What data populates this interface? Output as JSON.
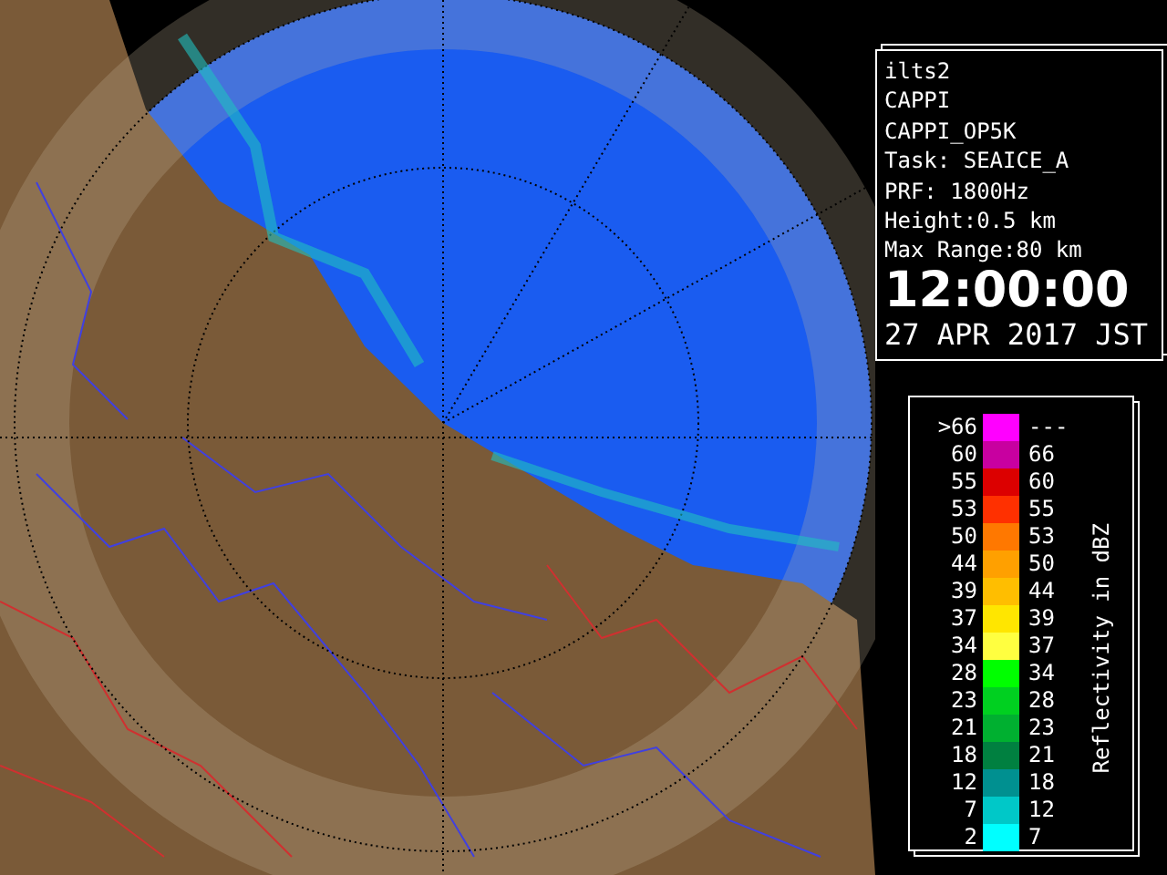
{
  "info_panel": {
    "lines": [
      "ilts2",
      "CAPPI",
      "CAPPI_OP5K",
      "Task: SEAICE_A",
      "PRF: 1800Hz",
      "Height:0.5 km",
      "Max Range:80 km"
    ],
    "time": "12:00:00",
    "date": "27 APR 2017 JST"
  },
  "legend": {
    "title": "Reflectivity in dBZ",
    "rows": [
      {
        "low": ">66",
        "high": "---",
        "color": "#ff00ff"
      },
      {
        "low": "60",
        "high": "66",
        "color": "#c800a0"
      },
      {
        "low": "55",
        "high": "60",
        "color": "#dc0000"
      },
      {
        "low": "53",
        "high": "55",
        "color": "#ff3000"
      },
      {
        "low": "50",
        "high": "53",
        "color": "#ff7800"
      },
      {
        "low": "44",
        "high": "50",
        "color": "#ffa000"
      },
      {
        "low": "39",
        "high": "44",
        "color": "#ffbe00"
      },
      {
        "low": "37",
        "high": "39",
        "color": "#ffe600"
      },
      {
        "low": "34",
        "high": "37",
        "color": "#ffff40"
      },
      {
        "low": "28",
        "high": "34",
        "color": "#00ff00"
      },
      {
        "low": "23",
        "high": "28",
        "color": "#00d020"
      },
      {
        "low": "21",
        "high": "23",
        "color": "#00b030"
      },
      {
        "low": "18",
        "high": "21",
        "color": "#008040"
      },
      {
        "low": "12",
        "high": "18",
        "color": "#009090"
      },
      {
        "low": "7",
        "high": "12",
        "color": "#00c8c8"
      },
      {
        "low": "2",
        "high": "7",
        "color": "#00ffff"
      }
    ]
  }
}
